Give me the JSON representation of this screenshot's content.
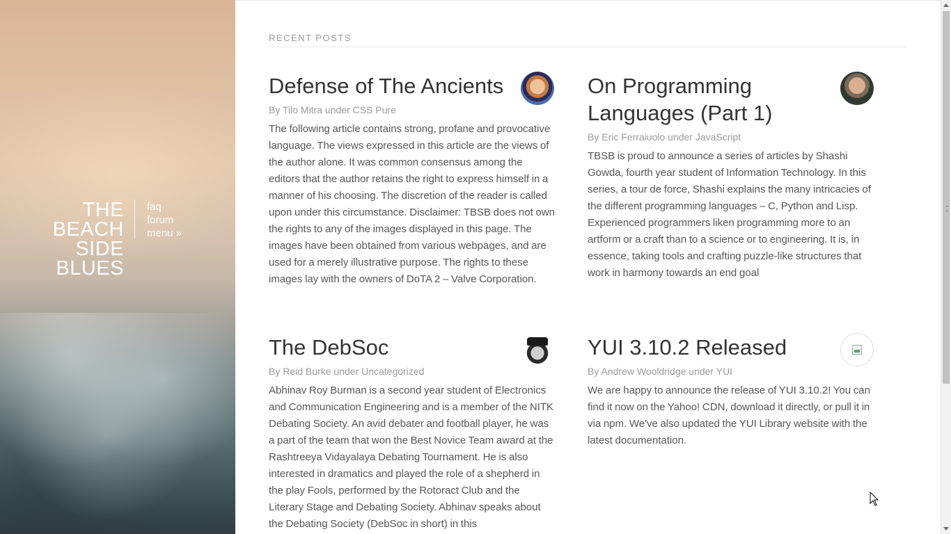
{
  "brand": {
    "lines": [
      "THE",
      "BEACH",
      "SIDE",
      "BLUES"
    ]
  },
  "nav": {
    "items": [
      "faq",
      "forum",
      "menu »"
    ]
  },
  "section": {
    "title": "RECENT POSTS"
  },
  "posts": [
    {
      "title": "Defense of The Ancients",
      "by": "By",
      "author": "Tilo Mitra",
      "under": "under",
      "category": "CSS Pure",
      "body": "The following article contains strong, profane and provocative language. The views expressed in this article are the views of the author alone. It was common consensus among the editors that the author retains the right to express himself in a manner of his choosing. The discretion of the reader is called upon under this circumstance. Disclaimer: TBSB does not own the rights to any of the images displayed in this page. The images have been obtained from various webpages, and are used for a merely illustrative purpose. The rights to these images lay with the owners of DoTA 2 – Valve Corporation."
    },
    {
      "title": "On Programming Languages (Part 1)",
      "by": "By",
      "author": "Eric Ferraiuolo",
      "under": "under",
      "category": "JavaScript",
      "body": "TBSB is proud to announce a series of articles by Shashi Gowda, fourth year student of Information Technology. In this series, a tour de force, Shashi explains the many intricacies of the different programming languages – C, Python and Lisp. Experienced programmers liken programming more to an artform or a craft than to a science or to engineering. It is, in essence, taking tools and crafting puzzle-like structures that work in harmony towards an end goal"
    },
    {
      "title": "The DebSoc",
      "by": "By",
      "author": "Reid Burke",
      "under": "under",
      "category": "Uncategorized",
      "body": "Abhinav Roy Burman is a second year student of Electronics and Communication Engineering and is a member of the NITK Debating Society. An avid debater and football player, he was a part of the team that won the Best Novice Team award at the Rashtreeya Vidayalaya Debating Tournament. He is also interested in dramatics and played the role of a shepherd in the play Fools, performed by the Rotoract Club and the Literary Stage and Debating Society. Abhinav speaks about the Debating Society (DebSoc in short) in this"
    },
    {
      "title": "YUI 3.10.2 Released",
      "by": "By",
      "author": "Andrew Wooldridge",
      "under": "under",
      "category": "YUI",
      "body": "We are happy to announce the release of YUI 3.10.2! You can find it now on the Yahoo! CDN, download it directly, or pull it in via npm. We've also updated the YUI Library website with the latest documentation."
    }
  ],
  "colors": {
    "title": "#333333",
    "meta": "#999999",
    "body": "#555555"
  }
}
